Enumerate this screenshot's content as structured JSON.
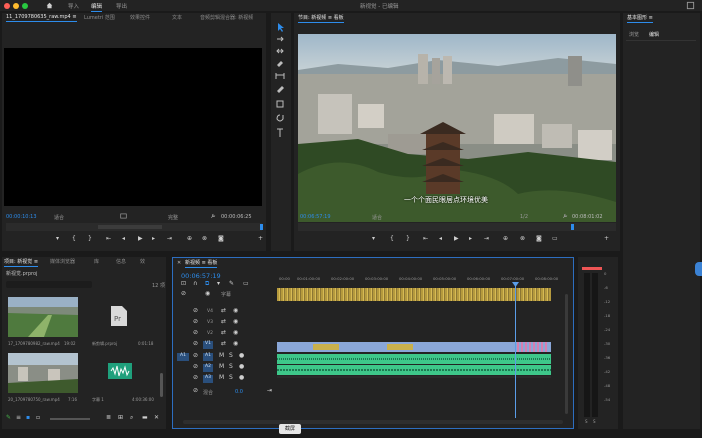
{
  "app": {
    "title": "新视觉 - 已编辑"
  },
  "workspaces": [
    "导入",
    "编辑",
    "导出"
  ],
  "source_panel": {
    "tabs": [
      "11_1709780635_raw.mp4 ≡",
      "Lumetri 范围",
      "效果控件",
      "文本",
      "音频剪辑混合器: 新视频"
    ],
    "timecode": "00:00:10:13",
    "fit": "适合",
    "quality": "完整",
    "duration": "00:00:06:25"
  },
  "program_panel": {
    "title": "节目: 新视频 ≡ 看板",
    "subtitle": "一个个面民眼居点环境优美",
    "timecode": "00:06:57:19",
    "fit": "适合",
    "ratio": "1/2",
    "duration": "00:08:01:02"
  },
  "properties_panel": {
    "title": "基本图形 ≡",
    "tabs": [
      "浏览",
      "编辑"
    ]
  },
  "project_panel": {
    "tabs": [
      "项目: 新视觉 ≡",
      "媒体浏览器",
      "库",
      "信息",
      "效"
    ],
    "path": "新视觉.prproj",
    "count": "12 项",
    "items": [
      {
        "name": "17_1709780982_raw.mp4",
        "duration": "19:02"
      },
      {
        "name": "新剪辑.prproj",
        "duration": "0:01:18"
      },
      {
        "name": "20_1709780750_raw.mp4",
        "duration": "7:16"
      },
      {
        "name": "字幕 1",
        "duration": "4:00:36:00"
      }
    ]
  },
  "timeline_panel": {
    "title": "新视频 ≡ 看板",
    "timecode": "00:06:57:19",
    "ruler": [
      "00:00",
      "00:01:00:00",
      "00:02:00:00",
      "00:03:00:00",
      "00:04:00:00",
      "00:05:00:00",
      "00:06:00:00",
      "00:07:00:00",
      "00:08:00:00"
    ],
    "tracks": [
      "V4",
      "V3",
      "V2",
      "V1",
      "A1",
      "A2",
      "A3"
    ],
    "master": "混合",
    "master_value": "0.0"
  },
  "meter": {
    "scale": [
      "0",
      "-6",
      "-12",
      "-18",
      "-24",
      "-30",
      "-36",
      "-42",
      "-48",
      "-54"
    ],
    "bottom": [
      "S",
      "S"
    ]
  },
  "caption_button": "截屏"
}
